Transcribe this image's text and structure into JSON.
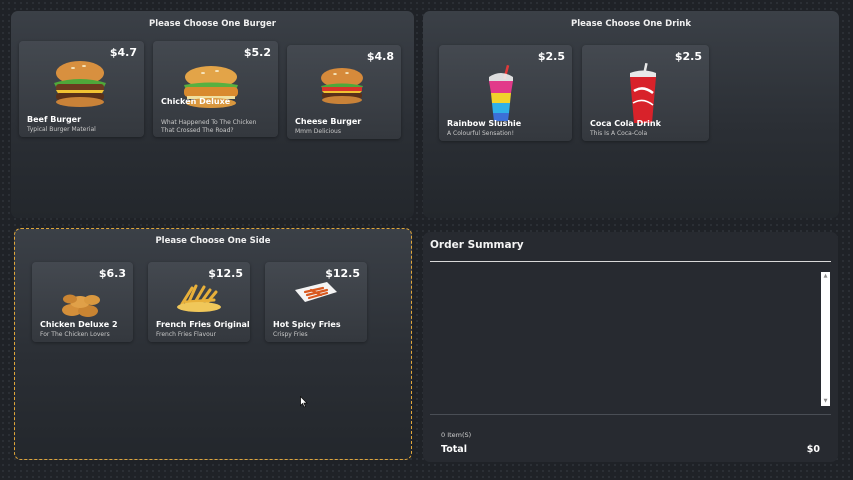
{
  "burgers": {
    "title": "Please Choose One Burger",
    "items": [
      {
        "name": "Beef Burger",
        "desc": "Typical Burger Material",
        "price": "$4.7",
        "icon": "beef-burger-icon"
      },
      {
        "name": "Chicken Deluxe",
        "desc": "What Happened To The Chicken That Crossed The Road?",
        "price": "$5.2",
        "icon": "chicken-burger-icon"
      },
      {
        "name": "Cheese Burger",
        "desc": "Mmm Delicious",
        "price": "$4.8",
        "icon": "cheese-burger-icon"
      }
    ]
  },
  "drinks": {
    "title": "Please Choose One Drink",
    "items": [
      {
        "name": "Rainbow Slushie",
        "desc": "A Colourful Sensation!",
        "price": "$2.5",
        "icon": "slushie-icon"
      },
      {
        "name": "Coca Cola Drink",
        "desc": "This Is A Coca-Cola",
        "price": "$2.5",
        "icon": "cola-cup-icon"
      }
    ]
  },
  "sides": {
    "title": "Please Choose One Side",
    "items": [
      {
        "name": "Chicken Deluxe 2",
        "desc": "For The Chicken Lovers",
        "price": "$6.3",
        "icon": "chicken-nuggets-icon"
      },
      {
        "name": "French Fries Original",
        "desc": "French Fries Flavour",
        "price": "$12.5",
        "icon": "french-fries-icon"
      },
      {
        "name": "Hot Spicy Fries",
        "desc": "Crispy Fries",
        "price": "$12.5",
        "icon": "spicy-fries-icon"
      }
    ]
  },
  "summary": {
    "title": "Order Summary",
    "count": "0 Item(S)",
    "total_label": "Total",
    "total_value": "$0"
  },
  "colors": {
    "selection_border": "#e0a63a",
    "background": "#1f2227"
  }
}
